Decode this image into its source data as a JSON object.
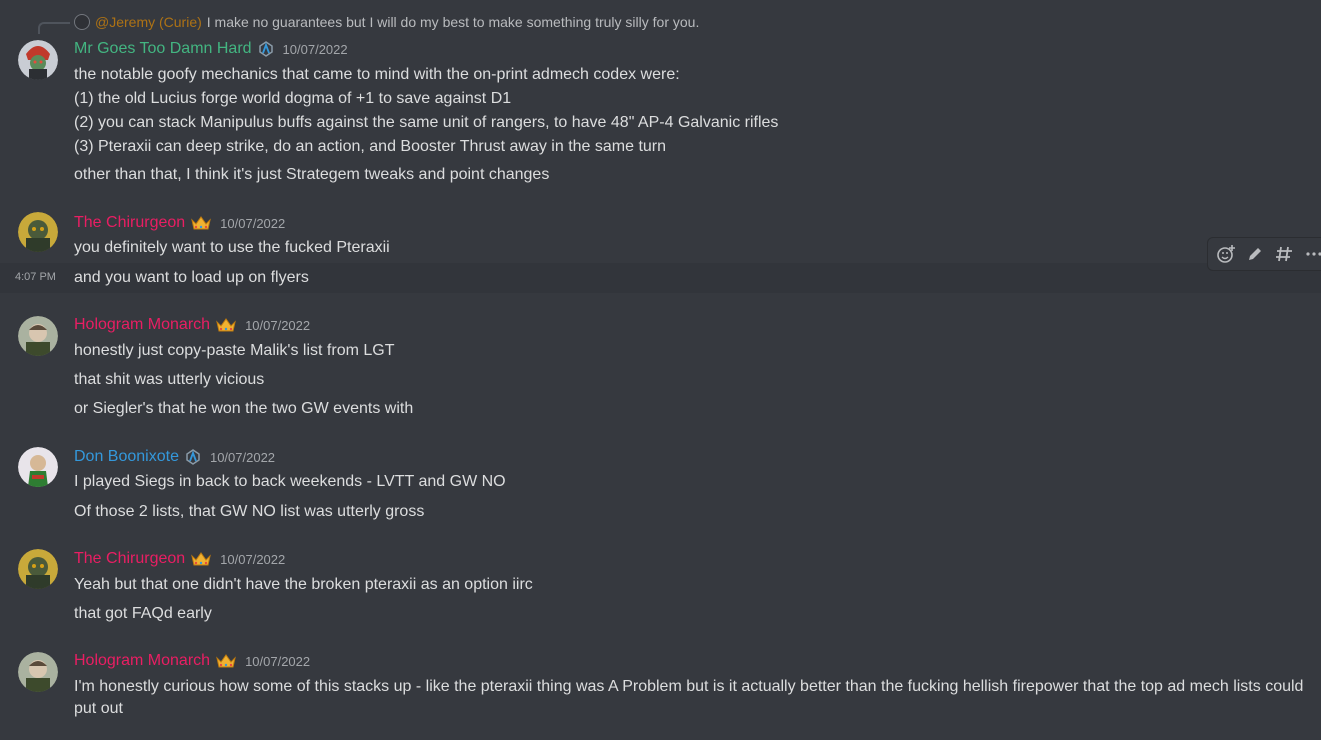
{
  "colors": {
    "green": "#43b581",
    "red": "#e91e63",
    "blue": "#3498db",
    "gold": "#c27c0e",
    "bg": "#36393f"
  },
  "reply": {
    "user": "@Jeremy (Curie)",
    "text": "I make no guarantees but I will do my best to make something truly silly for you."
  },
  "hover": {
    "time": "4:07 PM"
  },
  "toolbar": {
    "icons": [
      "add-reaction-icon",
      "edit-icon",
      "thread-icon",
      "more-icon"
    ]
  },
  "messages": [
    {
      "author": "Mr Goes Too Damn Hard",
      "badge": "boost-icon",
      "timestamp": "10/07/2022",
      "lines": [
        "the notable goofy mechanics that came to mind with the on-print admech codex were:",
        "(1) the old Lucius forge world dogma of +1 to save against D1",
        "(2) you can stack Manipulus buffs against the same unit of rangers, to have 48\" AP-4 Galvanic rifles",
        "(3) Pteraxii can deep strike, do an action, and Booster Thrust away in the same turn",
        "other than that, I think it's just Strategem tweaks and point changes"
      ]
    },
    {
      "author": "The Chirurgeon",
      "badge": "crown-icon",
      "timestamp": "10/07/2022",
      "lines": [
        "you definitely want to use the fucked Pteraxii",
        "and you want to load up on flyers"
      ]
    },
    {
      "author": "Hologram Monarch",
      "badge": "crown-icon",
      "timestamp": "10/07/2022",
      "lines": [
        "honestly just copy-paste Malik's list from LGT",
        "that shit was utterly vicious",
        "or Siegler's that he won the two GW events with"
      ]
    },
    {
      "author": "Don Boonixote",
      "badge": "boost-icon",
      "timestamp": "10/07/2022",
      "lines": [
        "I played Siegs in back to back weekends - LVTT and GW NO",
        "Of those 2 lists, that GW NO list was utterly gross"
      ]
    },
    {
      "author": "The Chirurgeon",
      "badge": "crown-icon",
      "timestamp": "10/07/2022",
      "lines": [
        "Yeah but that one didn't have the broken pteraxii as an option iirc",
        "that got FAQd early"
      ]
    },
    {
      "author": "Hologram Monarch",
      "badge": "crown-icon",
      "timestamp": "10/07/2022",
      "lines": [
        "I'm honestly curious how some of this stacks up - like the pteraxii thing was A Problem but is it actually better than the fucking hellish firepower that the top ad mech lists could put out"
      ]
    }
  ]
}
